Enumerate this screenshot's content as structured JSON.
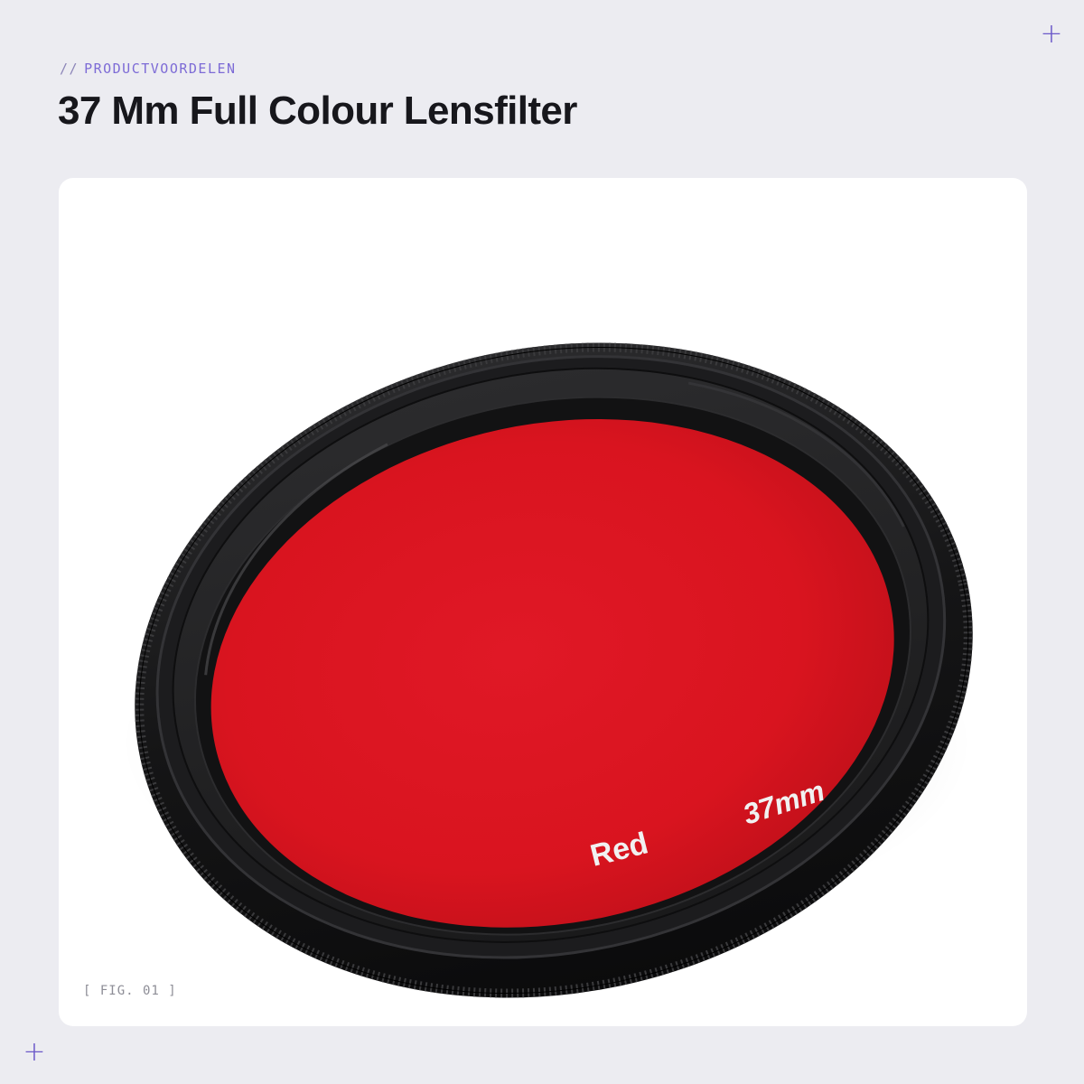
{
  "header": {
    "kicker_prefix": "//",
    "kicker": "PRODUCTVOORDELEN",
    "title": "37 Mm Full Colour Lensfilter"
  },
  "figure": {
    "caption": "[ FIG. 01 ]",
    "product_image": {
      "subject": "red-lens-filter",
      "ring_text_color_label": "Red",
      "ring_text_size_label": "37mm",
      "filter_color": "#d9141f",
      "ring_color": "#161616"
    }
  },
  "decorations": {
    "corner_marker_color": "#6b59c9",
    "corner_marker_glyph": "+"
  },
  "colors": {
    "background": "#ececf1",
    "card": "#ffffff",
    "accent": "#7d6bd6",
    "title": "#17171c"
  }
}
